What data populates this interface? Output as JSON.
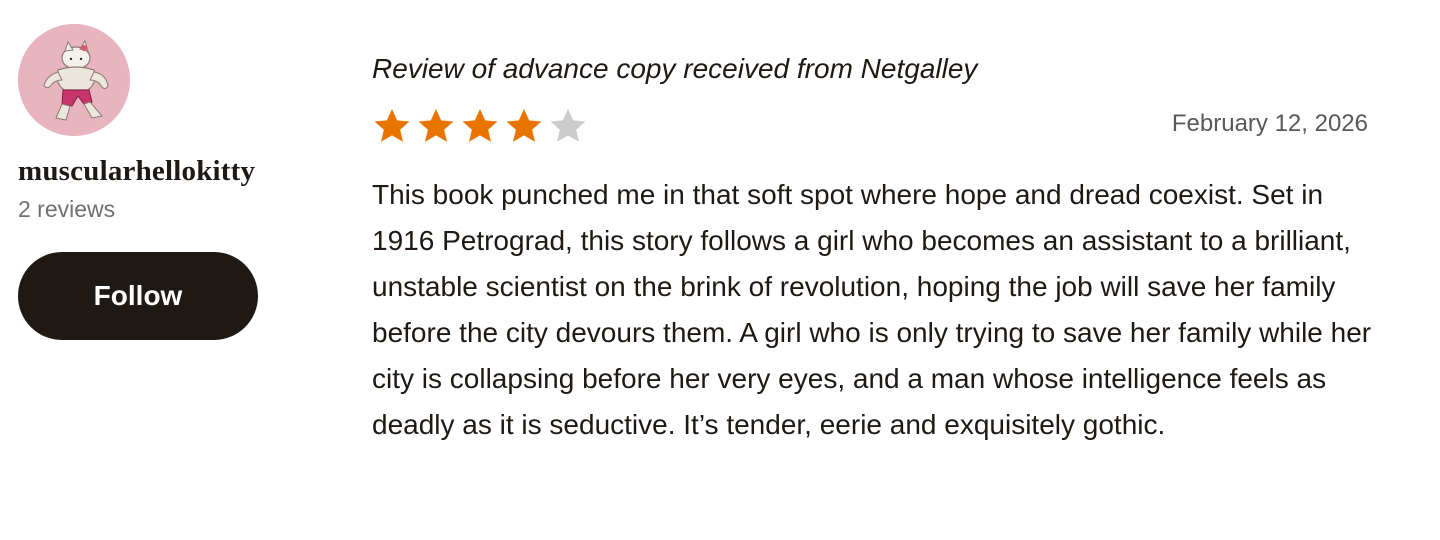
{
  "reviewer": {
    "username": "muscularhellokitty",
    "review_count": "2 reviews",
    "follow_label": "Follow"
  },
  "review": {
    "title": "Review of advance copy received from Netgalley",
    "rating": 4,
    "rating_max": 5,
    "date": "February 12, 2026",
    "body": "This book punched me in that soft spot where hope and dread coexist. Set in 1916 Petrograd, this story follows a girl who becomes an assistant to a brilliant, unstable scientist on the brink of revolution, hoping the job will save her family before the city devours them. A girl who is only trying to save her family while her city is collapsing before her very eyes, and a man whose intelligence feels as deadly as it is seductive. It’s tender, eerie and exquisitely gothic."
  },
  "colors": {
    "star_filled": "#e87400",
    "star_empty": "#cccccc",
    "button_bg": "#1e1915",
    "avatar_bg": "#e8b4c0"
  },
  "icons": {
    "star": "star-icon",
    "avatar": "avatar-image"
  }
}
